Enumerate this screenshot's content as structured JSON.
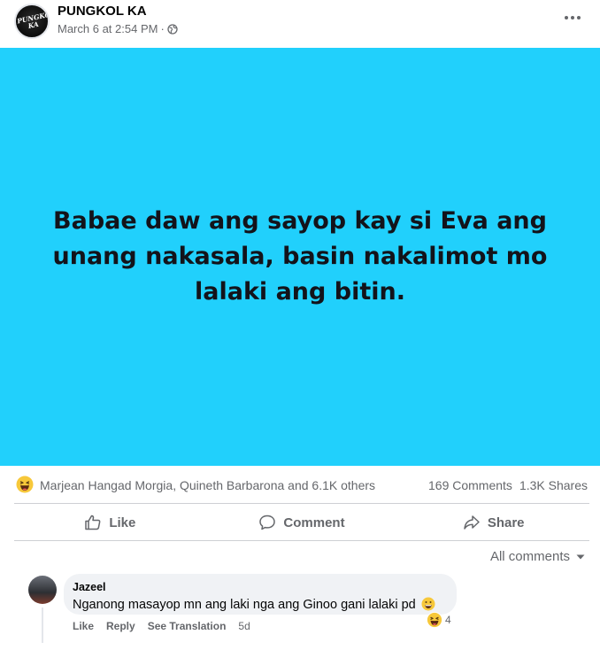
{
  "post": {
    "page_name": "PUNGKOL KA",
    "avatar_logo_text": "PUNGKOL KA",
    "timestamp": "March 6 at 2:54 PM",
    "separator": "·",
    "privacy_icon": "globe-icon",
    "more_icon": "more-options-icon",
    "text": "Babae daw ang sayop kay si Eva ang unang nakasala, basin nakalimot mo lalaki ang bitin.",
    "background_color": "#21d0fc"
  },
  "reactions": {
    "icon": "haha-reaction-icon",
    "reactors": "Marjean Hangad Morgia, Quineth Barbarona and 6.1K others",
    "comments_count": "169 Comments",
    "shares_count": "1.3K Shares"
  },
  "actions": {
    "like": "Like",
    "comment": "Comment",
    "share": "Share"
  },
  "comments_filter": {
    "label": "All comments"
  },
  "comment": {
    "author": "Jazeel",
    "text": "Nganong masayop mn ang laki nga ang Ginoo gani lalaki pd",
    "reaction_count": "4",
    "like": "Like",
    "reply": "Reply",
    "see_translation": "See Translation",
    "time": "5d"
  }
}
